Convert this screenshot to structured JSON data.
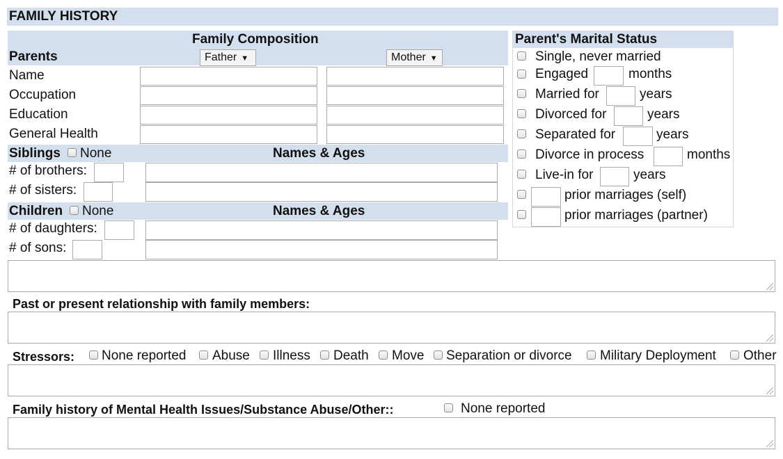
{
  "section": {
    "title": "FAMILY HISTORY"
  },
  "family_composition": {
    "title": "Family Composition",
    "parents_label": "Parents",
    "father_select": "Father",
    "mother_select": "Mother",
    "rows": [
      "Name",
      "Occupation",
      "Education",
      "General Health"
    ]
  },
  "siblings": {
    "label": "Siblings",
    "none_label": "None",
    "names_ages": "Names & Ages",
    "brothers_label": "# of brothers:",
    "sisters_label": "# of sisters:"
  },
  "children": {
    "label": "Children",
    "none_label": "None",
    "names_ages": "Names & Ages",
    "daughters_label": "# of daughters:",
    "sons_label": "# of sons:"
  },
  "marital_status": {
    "title": "Parent's Marital Status",
    "single": "Single, never married",
    "engaged": "Engaged",
    "engaged_unit": "months",
    "married": "Married for",
    "married_unit": "years",
    "divorced": "Divorced for",
    "divorced_unit": "years",
    "separated": "Separated for",
    "separated_unit": "years",
    "divorce_in_process": "Divorce in process",
    "divorce_in_process_unit": "months",
    "live_in": "Live-in for",
    "live_in_unit": "years",
    "prior_self": "prior marriages (self)",
    "prior_partner": "prior marriages (partner)"
  },
  "relationship": {
    "label": "Past or present relationship with family members:"
  },
  "stressors": {
    "label": "Stressors:",
    "options": [
      "None reported",
      "Abuse",
      "Illness",
      "Death",
      "Move",
      "Separation or divorce",
      "Military Deployment",
      "Other"
    ]
  },
  "mental_health": {
    "label": "Family history of Mental Health Issues/Substance Abuse/Other::",
    "none_label": "None reported"
  },
  "colors": {
    "band": "#d3dfec",
    "border": "#a9a9a9"
  }
}
